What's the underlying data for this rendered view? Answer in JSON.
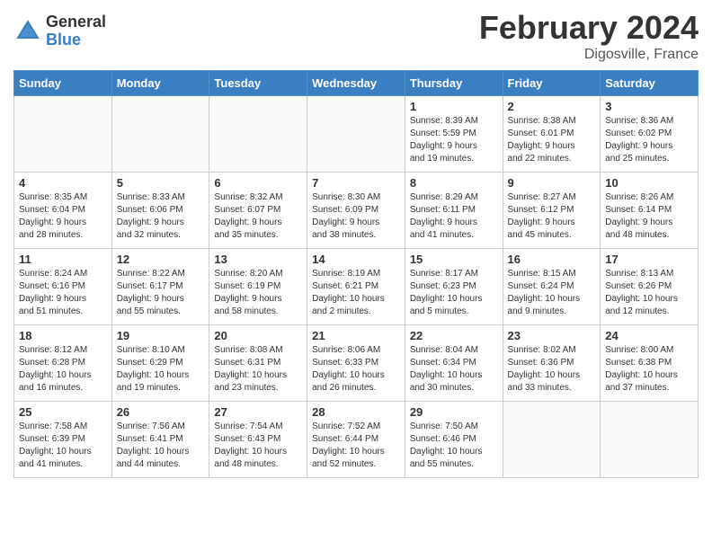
{
  "header": {
    "logo_general": "General",
    "logo_blue": "Blue",
    "month_title": "February 2024",
    "location": "Digosville, France"
  },
  "days_of_week": [
    "Sunday",
    "Monday",
    "Tuesday",
    "Wednesday",
    "Thursday",
    "Friday",
    "Saturday"
  ],
  "weeks": [
    [
      {
        "day": "",
        "info": ""
      },
      {
        "day": "",
        "info": ""
      },
      {
        "day": "",
        "info": ""
      },
      {
        "day": "",
        "info": ""
      },
      {
        "day": "1",
        "info": "Sunrise: 8:39 AM\nSunset: 5:59 PM\nDaylight: 9 hours\nand 19 minutes."
      },
      {
        "day": "2",
        "info": "Sunrise: 8:38 AM\nSunset: 6:01 PM\nDaylight: 9 hours\nand 22 minutes."
      },
      {
        "day": "3",
        "info": "Sunrise: 8:36 AM\nSunset: 6:02 PM\nDaylight: 9 hours\nand 25 minutes."
      }
    ],
    [
      {
        "day": "4",
        "info": "Sunrise: 8:35 AM\nSunset: 6:04 PM\nDaylight: 9 hours\nand 28 minutes."
      },
      {
        "day": "5",
        "info": "Sunrise: 8:33 AM\nSunset: 6:06 PM\nDaylight: 9 hours\nand 32 minutes."
      },
      {
        "day": "6",
        "info": "Sunrise: 8:32 AM\nSunset: 6:07 PM\nDaylight: 9 hours\nand 35 minutes."
      },
      {
        "day": "7",
        "info": "Sunrise: 8:30 AM\nSunset: 6:09 PM\nDaylight: 9 hours\nand 38 minutes."
      },
      {
        "day": "8",
        "info": "Sunrise: 8:29 AM\nSunset: 6:11 PM\nDaylight: 9 hours\nand 41 minutes."
      },
      {
        "day": "9",
        "info": "Sunrise: 8:27 AM\nSunset: 6:12 PM\nDaylight: 9 hours\nand 45 minutes."
      },
      {
        "day": "10",
        "info": "Sunrise: 8:26 AM\nSunset: 6:14 PM\nDaylight: 9 hours\nand 48 minutes."
      }
    ],
    [
      {
        "day": "11",
        "info": "Sunrise: 8:24 AM\nSunset: 6:16 PM\nDaylight: 9 hours\nand 51 minutes."
      },
      {
        "day": "12",
        "info": "Sunrise: 8:22 AM\nSunset: 6:17 PM\nDaylight: 9 hours\nand 55 minutes."
      },
      {
        "day": "13",
        "info": "Sunrise: 8:20 AM\nSunset: 6:19 PM\nDaylight: 9 hours\nand 58 minutes."
      },
      {
        "day": "14",
        "info": "Sunrise: 8:19 AM\nSunset: 6:21 PM\nDaylight: 10 hours\nand 2 minutes."
      },
      {
        "day": "15",
        "info": "Sunrise: 8:17 AM\nSunset: 6:23 PM\nDaylight: 10 hours\nand 5 minutes."
      },
      {
        "day": "16",
        "info": "Sunrise: 8:15 AM\nSunset: 6:24 PM\nDaylight: 10 hours\nand 9 minutes."
      },
      {
        "day": "17",
        "info": "Sunrise: 8:13 AM\nSunset: 6:26 PM\nDaylight: 10 hours\nand 12 minutes."
      }
    ],
    [
      {
        "day": "18",
        "info": "Sunrise: 8:12 AM\nSunset: 6:28 PM\nDaylight: 10 hours\nand 16 minutes."
      },
      {
        "day": "19",
        "info": "Sunrise: 8:10 AM\nSunset: 6:29 PM\nDaylight: 10 hours\nand 19 minutes."
      },
      {
        "day": "20",
        "info": "Sunrise: 8:08 AM\nSunset: 6:31 PM\nDaylight: 10 hours\nand 23 minutes."
      },
      {
        "day": "21",
        "info": "Sunrise: 8:06 AM\nSunset: 6:33 PM\nDaylight: 10 hours\nand 26 minutes."
      },
      {
        "day": "22",
        "info": "Sunrise: 8:04 AM\nSunset: 6:34 PM\nDaylight: 10 hours\nand 30 minutes."
      },
      {
        "day": "23",
        "info": "Sunrise: 8:02 AM\nSunset: 6:36 PM\nDaylight: 10 hours\nand 33 minutes."
      },
      {
        "day": "24",
        "info": "Sunrise: 8:00 AM\nSunset: 6:38 PM\nDaylight: 10 hours\nand 37 minutes."
      }
    ],
    [
      {
        "day": "25",
        "info": "Sunrise: 7:58 AM\nSunset: 6:39 PM\nDaylight: 10 hours\nand 41 minutes."
      },
      {
        "day": "26",
        "info": "Sunrise: 7:56 AM\nSunset: 6:41 PM\nDaylight: 10 hours\nand 44 minutes."
      },
      {
        "day": "27",
        "info": "Sunrise: 7:54 AM\nSunset: 6:43 PM\nDaylight: 10 hours\nand 48 minutes."
      },
      {
        "day": "28",
        "info": "Sunrise: 7:52 AM\nSunset: 6:44 PM\nDaylight: 10 hours\nand 52 minutes."
      },
      {
        "day": "29",
        "info": "Sunrise: 7:50 AM\nSunset: 6:46 PM\nDaylight: 10 hours\nand 55 minutes."
      },
      {
        "day": "",
        "info": ""
      },
      {
        "day": "",
        "info": ""
      }
    ]
  ]
}
